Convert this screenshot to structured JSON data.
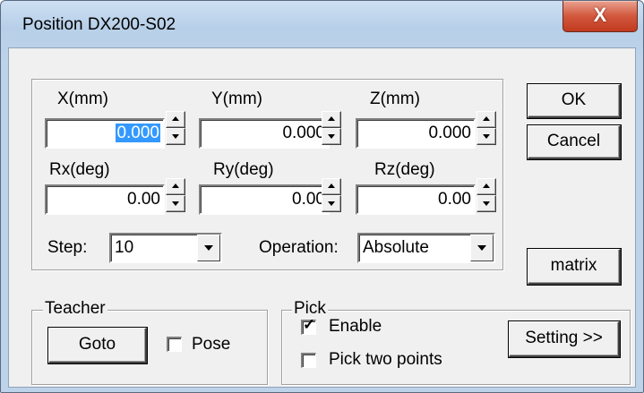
{
  "window": {
    "title": "Position DX200-S02",
    "close_glyph": "X"
  },
  "coords": {
    "x_label": "X(mm)",
    "x_value": "0.000",
    "y_label": "Y(mm)",
    "y_value": "0.000",
    "z_label": "Z(mm)",
    "z_value": "0.000",
    "rx_label": "Rx(deg)",
    "rx_value": "0.00",
    "ry_label": "Ry(deg)",
    "ry_value": "0.00",
    "rz_label": "Rz(deg)",
    "rz_value": "0.00"
  },
  "step": {
    "label": "Step:",
    "value": "10"
  },
  "operation": {
    "label": "Operation:",
    "value": "Absolute"
  },
  "buttons": {
    "ok": "OK",
    "cancel": "Cancel",
    "matrix": "matrix",
    "goto": "Goto",
    "setting": "Setting >>"
  },
  "teacher": {
    "legend": "Teacher",
    "pose_label": "Pose",
    "pose_checked": false
  },
  "pick": {
    "legend": "Pick",
    "enable_label": "Enable",
    "enable_checked": true,
    "two_points_label": "Pick two points",
    "two_points_checked": false
  }
}
